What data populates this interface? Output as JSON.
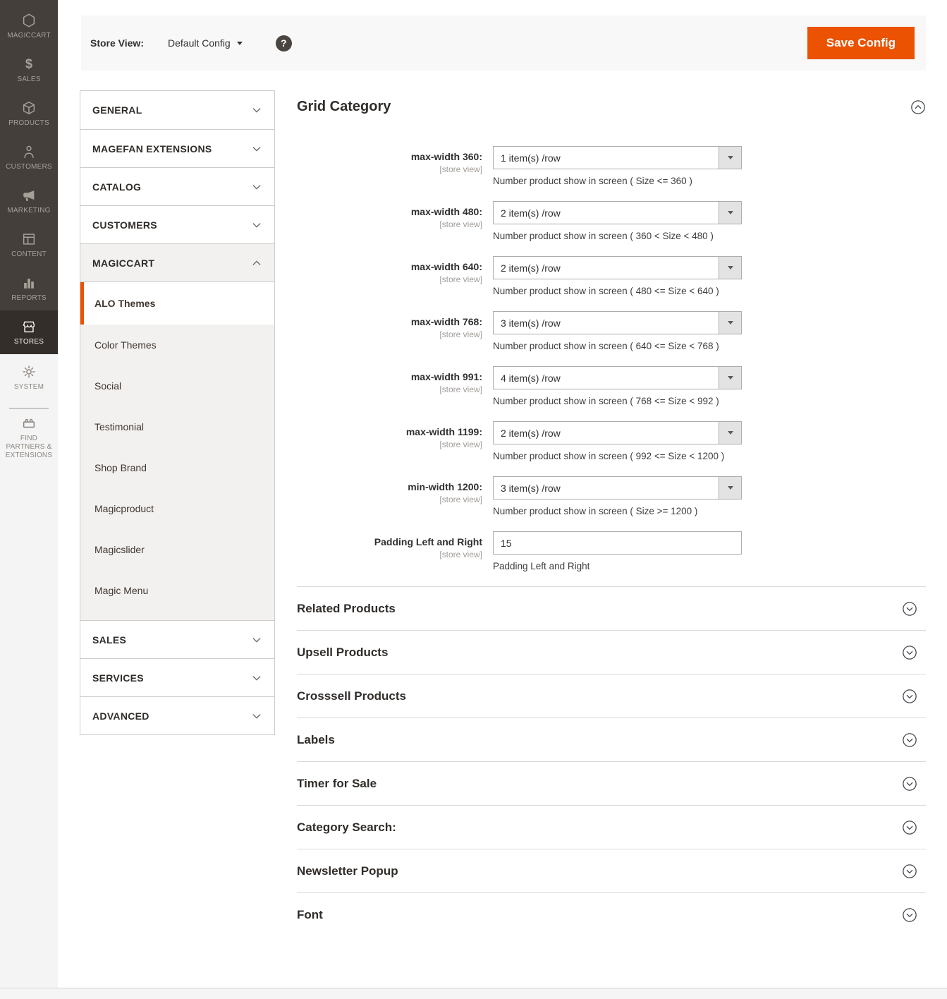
{
  "colors": {
    "accent": "#eb5202",
    "sidebar_dark": "#453f3b",
    "sidebar_active": "#332e2a",
    "topbar_bg": "#f8f8f8",
    "nav_expanded_bg": "#f2f1f0"
  },
  "sidebar": {
    "items": [
      {
        "label": "MAGICCART",
        "icon": "magiccart",
        "zone": "dark",
        "active": false
      },
      {
        "label": "SALES",
        "icon": "sales",
        "zone": "dark",
        "active": false
      },
      {
        "label": "PRODUCTS",
        "icon": "products",
        "zone": "dark",
        "active": false
      },
      {
        "label": "CUSTOMERS",
        "icon": "customers",
        "zone": "dark",
        "active": false
      },
      {
        "label": "MARKETING",
        "icon": "marketing",
        "zone": "dark",
        "active": false
      },
      {
        "label": "CONTENT",
        "icon": "content",
        "zone": "dark",
        "active": false
      },
      {
        "label": "REPORTS",
        "icon": "reports",
        "zone": "dark",
        "active": false
      },
      {
        "label": "STORES",
        "icon": "stores",
        "zone": "dark",
        "active": true
      },
      {
        "label": "SYSTEM",
        "icon": "system",
        "zone": "light",
        "active": false
      },
      {
        "label": "FIND PARTNERS & EXTENSIONS",
        "icon": "find-partners",
        "zone": "light",
        "active": false
      }
    ]
  },
  "header": {
    "store_view_label": "Store View:",
    "store_view_value": "Default Config",
    "help_glyph": "?",
    "save_label": "Save Config"
  },
  "nav": {
    "sections": [
      {
        "label": "GENERAL",
        "expanded": false
      },
      {
        "label": "MAGEFAN EXTENSIONS",
        "expanded": false
      },
      {
        "label": "CATALOG",
        "expanded": false
      },
      {
        "label": "CUSTOMERS",
        "expanded": false
      },
      {
        "label": "MAGICCART",
        "expanded": true,
        "children": [
          {
            "label": "ALO Themes",
            "active": true
          },
          {
            "label": "Color Themes",
            "active": false
          },
          {
            "label": "Social",
            "active": false
          },
          {
            "label": "Testimonial",
            "active": false
          },
          {
            "label": "Shop Brand",
            "active": false
          },
          {
            "label": "Magicproduct",
            "active": false
          },
          {
            "label": "Magicslider",
            "active": false
          },
          {
            "label": "Magic Menu",
            "active": false
          }
        ]
      },
      {
        "label": "SALES",
        "expanded": false
      },
      {
        "label": "SERVICES",
        "expanded": false
      },
      {
        "label": "ADVANCED",
        "expanded": false
      }
    ]
  },
  "main": {
    "section_title": "Grid Category",
    "fields": [
      {
        "label": "max-width 360:",
        "scope": "[store view]",
        "control": "select",
        "value": "1 item(s) /row",
        "note": "Number product show in screen ( Size <= 360 )"
      },
      {
        "label": "max-width 480:",
        "scope": "[store view]",
        "control": "select",
        "value": "2 item(s) /row",
        "note": "Number product show in screen ( 360 < Size < 480 )"
      },
      {
        "label": "max-width 640:",
        "scope": "[store view]",
        "control": "select",
        "value": "2 item(s) /row",
        "note": "Number product show in screen ( 480 <= Size < 640 )"
      },
      {
        "label": "max-width 768:",
        "scope": "[store view]",
        "control": "select",
        "value": "3 item(s) /row",
        "note": "Number product show in screen ( 640 <= Size < 768 )"
      },
      {
        "label": "max-width 991:",
        "scope": "[store view]",
        "control": "select",
        "value": "4 item(s) /row",
        "note": "Number product show in screen ( 768 <= Size < 992 )"
      },
      {
        "label": "max-width 1199:",
        "scope": "[store view]",
        "control": "select",
        "value": "2 item(s) /row",
        "note": "Number product show in screen ( 992 <= Size < 1200 )"
      },
      {
        "label": "min-width 1200:",
        "scope": "[store view]",
        "control": "select",
        "value": "3 item(s) /row",
        "note": "Number product show in screen ( Size >= 1200 )"
      },
      {
        "label": "Padding Left and Right",
        "scope": "[store view]",
        "control": "text",
        "value": "15",
        "note": "Padding Left and Right"
      }
    ],
    "collapsed_sections": [
      "Related Products",
      "Upsell Products",
      "Crosssell Products",
      "Labels",
      "Timer for Sale",
      "Category Search:",
      "Newsletter Popup",
      "Font"
    ]
  }
}
